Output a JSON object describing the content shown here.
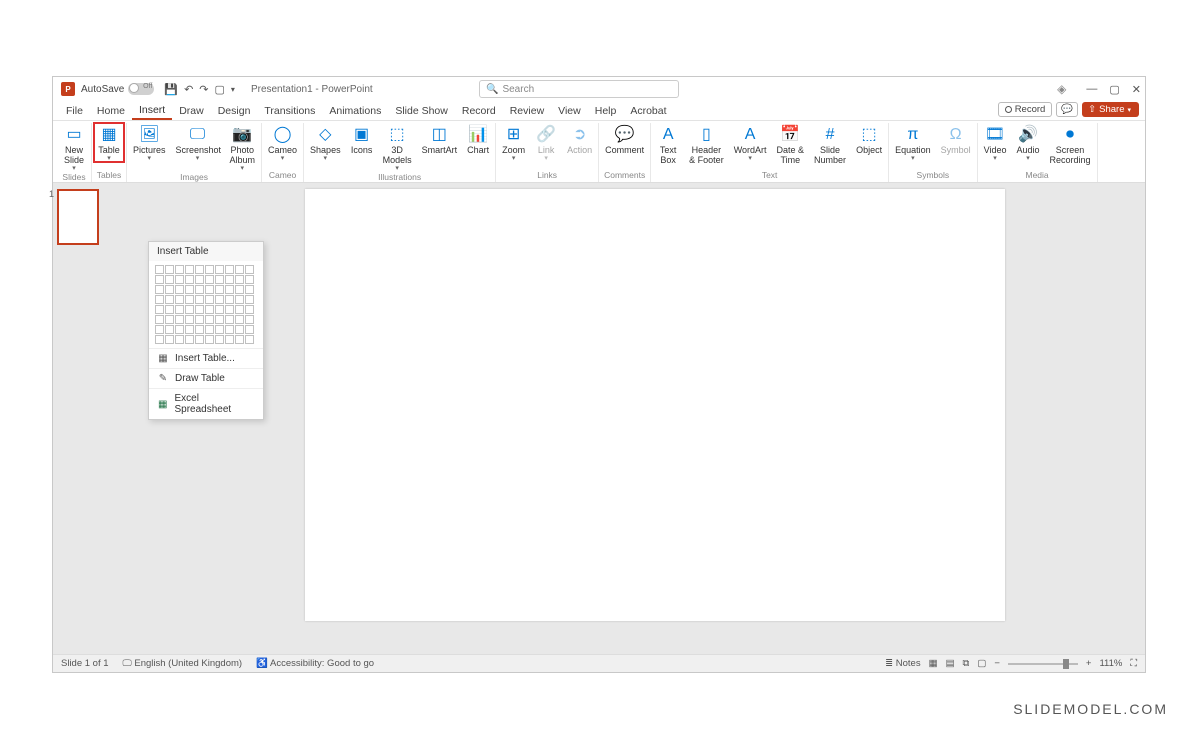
{
  "title": {
    "autosave_label": "AutoSave",
    "autosave_state": "Off",
    "doc": "Presentation1 - PowerPoint",
    "search_placeholder": "Search"
  },
  "tabs": [
    "File",
    "Home",
    "Insert",
    "Draw",
    "Design",
    "Transitions",
    "Animations",
    "Slide Show",
    "Record",
    "Review",
    "View",
    "Help",
    "Acrobat"
  ],
  "active_tab": "Insert",
  "tabs_right": {
    "record": "Record",
    "share": "Share"
  },
  "ribbon": {
    "slides": {
      "label": "Slides",
      "items": [
        {
          "l": "New\nSlide",
          "drop": true
        }
      ]
    },
    "tables": {
      "label": "Tables",
      "items": [
        {
          "l": "Table",
          "drop": true,
          "hl": true
        }
      ]
    },
    "images": {
      "label": "Images",
      "items": [
        {
          "l": "Pictures",
          "drop": true
        },
        {
          "l": "Screenshot",
          "drop": true
        },
        {
          "l": "Photo\nAlbum",
          "drop": true
        }
      ]
    },
    "cameo": {
      "label": "Cameo",
      "items": [
        {
          "l": "Cameo",
          "drop": true
        }
      ]
    },
    "illus": {
      "label": "Illustrations",
      "items": [
        {
          "l": "Shapes",
          "drop": true
        },
        {
          "l": "Icons"
        },
        {
          "l": "3D\nModels",
          "drop": true
        },
        {
          "l": "SmartArt"
        },
        {
          "l": "Chart"
        }
      ]
    },
    "links": {
      "label": "Links",
      "items": [
        {
          "l": "Zoom",
          "drop": true
        },
        {
          "l": "Link",
          "drop": true,
          "dis": true
        },
        {
          "l": "Action",
          "dis": true
        }
      ]
    },
    "comments": {
      "label": "Comments",
      "items": [
        {
          "l": "Comment"
        }
      ]
    },
    "text": {
      "label": "Text",
      "items": [
        {
          "l": "Text\nBox"
        },
        {
          "l": "Header\n& Footer"
        },
        {
          "l": "WordArt",
          "drop": true
        },
        {
          "l": "Date &\nTime"
        },
        {
          "l": "Slide\nNumber"
        },
        {
          "l": "Object"
        }
      ]
    },
    "symbols": {
      "label": "Symbols",
      "items": [
        {
          "l": "Equation",
          "drop": true
        },
        {
          "l": "Symbol",
          "dis": true
        }
      ]
    },
    "media": {
      "label": "Media",
      "items": [
        {
          "l": "Video",
          "drop": true
        },
        {
          "l": "Audio",
          "drop": true
        },
        {
          "l": "Screen\nRecording"
        }
      ]
    }
  },
  "table_popup": {
    "title": "Insert Table",
    "items": [
      "Insert Table...",
      "Draw Table",
      "Excel Spreadsheet"
    ]
  },
  "thumb": {
    "num": "1"
  },
  "status": {
    "slide": "Slide 1 of 1",
    "lang": "English (United Kingdom)",
    "acc": "Accessibility: Good to go",
    "notes": "Notes",
    "zoom": "111%"
  },
  "watermark": "SLIDEMODEL.COM"
}
